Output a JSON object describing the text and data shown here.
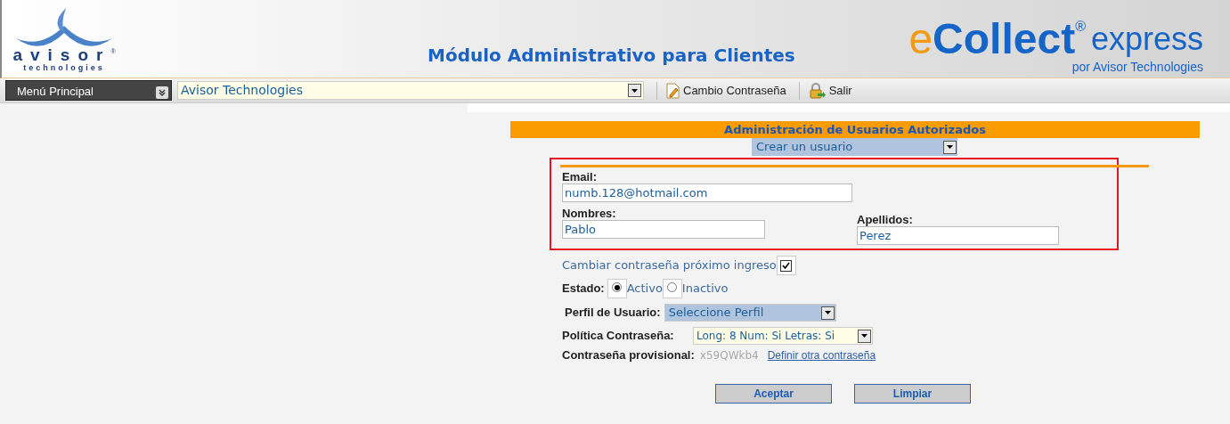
{
  "header": {
    "logo": {
      "name": "avisor",
      "mark": "®",
      "subtitle": "technologies"
    },
    "title": "Módulo Administrativo para Clientes",
    "brand": {
      "prefix": "e",
      "name": "Collect",
      "mark": "®",
      "suffix": "express",
      "tagline": "por Avisor Technologies"
    }
  },
  "toolbar": {
    "menu": "Menú Principal",
    "company": "Avisor Technologies",
    "actions": [
      {
        "label": "Cambio Contraseña",
        "kind": "password"
      },
      {
        "label": "Salir",
        "kind": "exit"
      }
    ]
  },
  "form": {
    "title": "Administración de Usuarios Autorizados",
    "action": "Crear un usuario",
    "email": {
      "label": "Email:",
      "value": "numb.128@hotmail.com"
    },
    "nombres": {
      "label": "Nombres:",
      "value": "Pablo"
    },
    "apellidos": {
      "label": "Apellidos:",
      "value": "Perez"
    },
    "change_password": {
      "label": "Cambiar contraseña próximo ingreso",
      "checked": true
    },
    "estado": {
      "label": "Estado:",
      "options": [
        {
          "label": "Activo",
          "selected": true
        },
        {
          "label": "Inactivo",
          "selected": false
        }
      ]
    },
    "perfil": {
      "label": "Perfil de Usuario:",
      "value": "Seleccione Perfil"
    },
    "politica": {
      "label": "Política Contraseña:",
      "value": "Long: 8 Num: Si Letras: Si"
    },
    "provisional": {
      "label": "Contraseña provisional:",
      "value": "x59QWkb4",
      "link": "Definir otra contraseña"
    },
    "buttons": [
      "Aceptar",
      "Limpiar"
    ]
  }
}
